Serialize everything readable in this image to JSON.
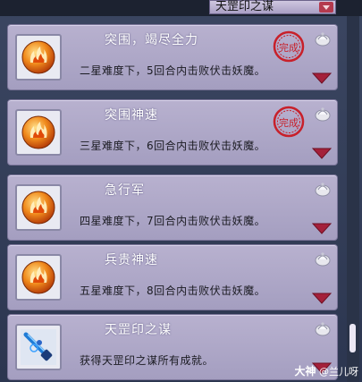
{
  "filter": {
    "selected": "天罡印之谋"
  },
  "achievements": [
    {
      "title": "突围，竭尽全力",
      "desc": "二星难度下，5回合内击败伏击妖魔。",
      "completed": true,
      "icon": "fire-orb-icon",
      "seal_text": "完成"
    },
    {
      "title": "突围神速",
      "desc": "三星难度下，6回合内击败伏击妖魔。",
      "completed": true,
      "icon": "fire-orb-icon",
      "seal_text": "完成"
    },
    {
      "title": "急行军",
      "desc": "四星难度下，7回合内击败伏击妖魔。",
      "completed": false,
      "icon": "fire-orb-icon"
    },
    {
      "title": "兵贵神速",
      "desc": "五星难度下，8回合内击败伏击妖魔。",
      "completed": false,
      "icon": "fire-orb-icon"
    },
    {
      "title": "天罡印之谋",
      "desc": "获得天罡印之谋所有成就。",
      "completed": false,
      "icon": "blue-sword-icon"
    }
  ],
  "watermark": {
    "brand": "大神",
    "user": "@兰儿呀"
  },
  "colors": {
    "card": "#a49ec0",
    "seal": "#c8202a",
    "expand_arrow": "#a4203a"
  }
}
